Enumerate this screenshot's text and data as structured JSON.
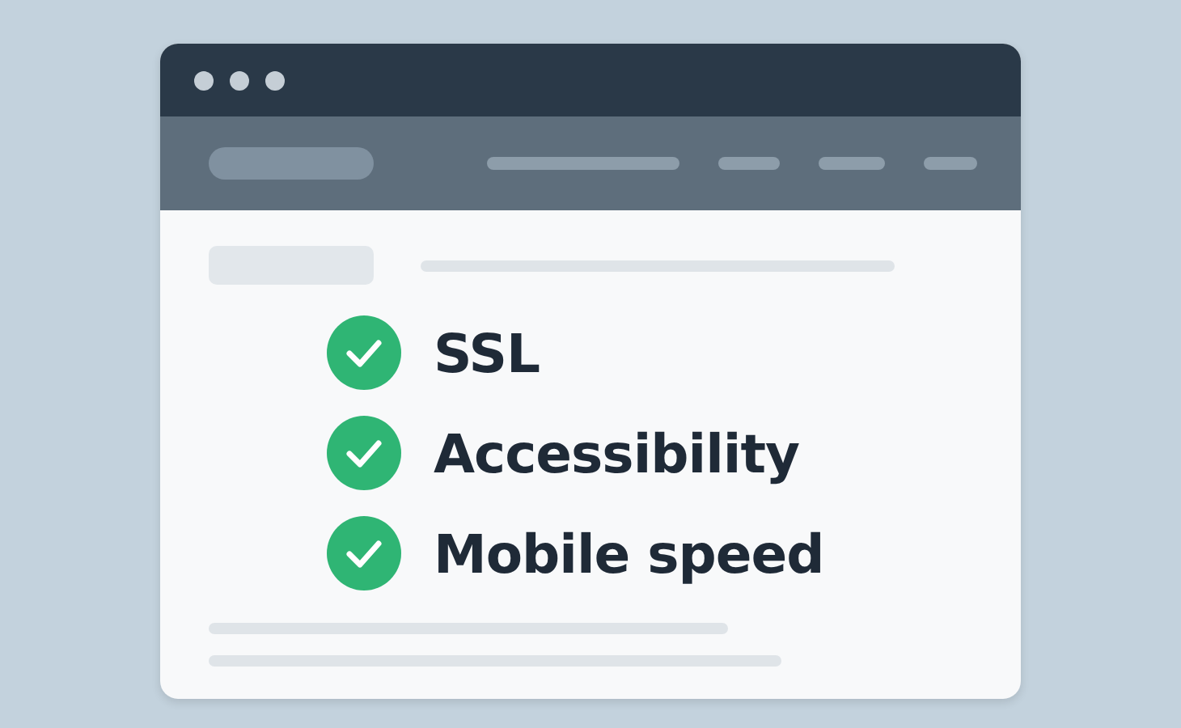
{
  "checklist": [
    {
      "label": "SSL",
      "checked": true
    },
    {
      "label": "Accessibility",
      "checked": true
    },
    {
      "label": "Mobile speed",
      "checked": true
    }
  ]
}
